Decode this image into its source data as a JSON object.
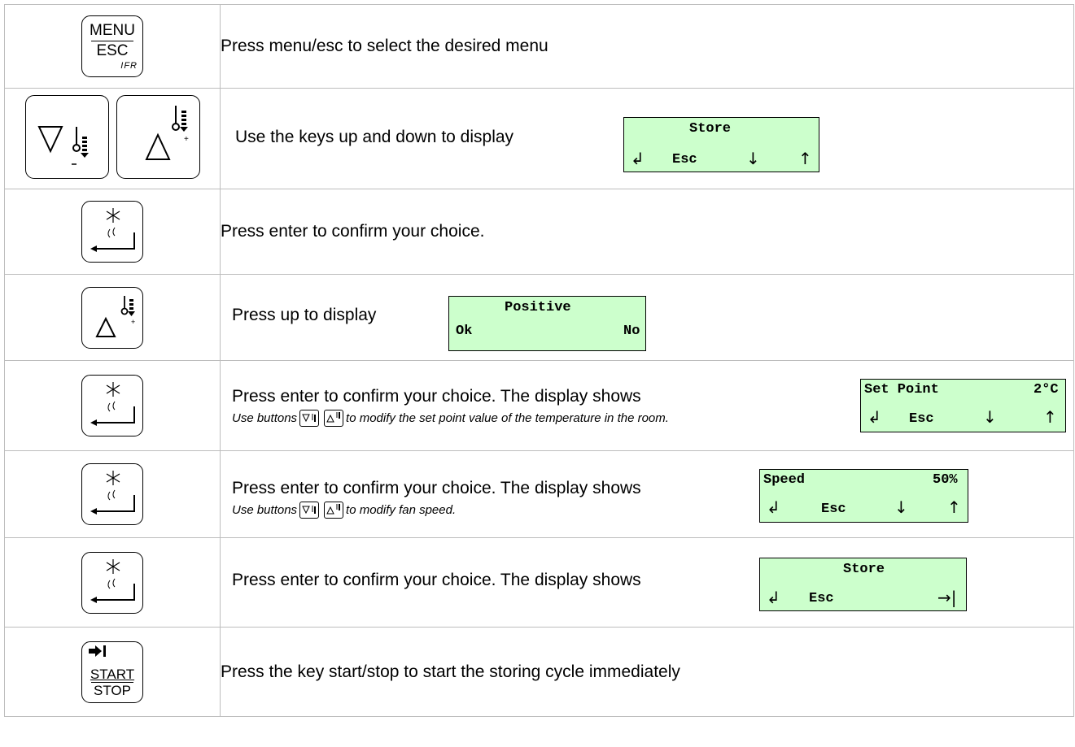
{
  "keys": {
    "menu": {
      "line1": "MENU",
      "line2": "ESC",
      "line3": "IFR"
    },
    "start_stop": {
      "line1": "START",
      "line2": "STOP"
    }
  },
  "rows": [
    {
      "text": "Press menu/esc to select the desired menu"
    },
    {
      "text": "Use the keys up and down to display",
      "lcd": {
        "top": "Store",
        "esc": "Esc",
        "enter_symbol": "↲",
        "down_symbol": "↓",
        "up_symbol": "↑"
      }
    },
    {
      "text": "Press enter to confirm your choice."
    },
    {
      "text": "Press up to display",
      "lcd": {
        "top": "Positive",
        "left": "Ok",
        "right": "No"
      }
    },
    {
      "text": "Press enter to confirm your choice. The display shows",
      "note_before": "Use buttons",
      "note_after": "to modify the set point value of the temperature in the room.",
      "lcd": {
        "label": "Set Point",
        "value": "2°C",
        "esc": "Esc",
        "enter_symbol": "↲",
        "down_symbol": "↓",
        "up_symbol": "↑"
      }
    },
    {
      "text": "Press enter to confirm your choice. The display shows",
      "note_before": "Use buttons",
      "note_after": "to modify fan speed.",
      "lcd": {
        "label": "Speed",
        "value": "50%",
        "esc": "Esc",
        "enter_symbol": "↲",
        "down_symbol": "↓",
        "up_symbol": "↑"
      }
    },
    {
      "text": "Press enter to confirm your choice. The display shows",
      "lcd": {
        "top": "Store",
        "esc": "Esc",
        "enter_symbol": "↲",
        "tab_symbol": "→|"
      }
    },
    {
      "text": "Press the key  start/stop to start the storing cycle immediately"
    }
  ],
  "icons": {
    "menu_key": "menu-esc-key-icon",
    "down_key": "down-triangle-thermometer-key-icon",
    "up_key": "up-triangle-thermometer-key-icon",
    "enter_key": "enter-snowflake-key-icon",
    "start_key": "start-stop-key-icon"
  },
  "colors": {
    "lcd_background": "#ccffcc",
    "grid": "#bdbdbd"
  }
}
